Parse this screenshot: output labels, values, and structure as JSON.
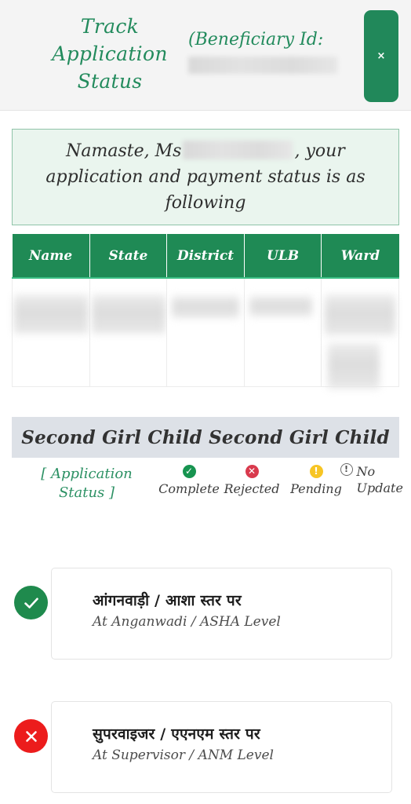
{
  "header": {
    "title": "Track Application Status",
    "beneficiary_label": "(Beneficiary Id:",
    "beneficiary_value": "",
    "close_label": "×"
  },
  "greeting": {
    "prefix": "Namaste, Ms",
    "name_value": "",
    "suffix": ", your application and payment status is as following"
  },
  "table": {
    "columns": [
      "Name",
      "State",
      "District",
      "ULB",
      "Ward"
    ],
    "rows": [
      {
        "Name": "",
        "State": "",
        "District": "",
        "ULB": "",
        "Ward": ""
      }
    ]
  },
  "section": {
    "header": "Second Girl Child Second Girl Child"
  },
  "legend": {
    "title": "[ Application Status ]",
    "items": [
      {
        "label": "Complete",
        "icon": "check-circle-icon",
        "glyph": "✓",
        "color": "#179450"
      },
      {
        "label": "Rejected",
        "icon": "x-circle-icon",
        "glyph": "✕",
        "color": "#d93a4d"
      },
      {
        "label": "Pending",
        "icon": "exclamation-circle-icon",
        "glyph": "!",
        "color": "#f7c524"
      },
      {
        "label": "No Update",
        "icon": "info-circle-outline-icon",
        "glyph": "!",
        "color": "#6b6b6b"
      }
    ]
  },
  "status_steps": [
    {
      "title_hi": "आंगनवाड़ी / आशा स्तर पर",
      "title_en": "At Anganwadi / ASHA Level",
      "status": "Complete",
      "icon": "check-circle-icon",
      "color": "#1f8a4d"
    },
    {
      "title_hi": "सुपरवाइजर / एएनएम स्तर पर",
      "title_en": "At Supervisor / ANM Level",
      "status": "Rejected",
      "icon": "x-circle-icon",
      "color": "#ec1c1c"
    }
  ],
  "colors": {
    "brand_green": "#21885a",
    "table_header_green": "#1f8a55",
    "banner_bg": "#eaf5ee",
    "section_bg": "#dde1e7",
    "complete": "#179450",
    "rejected": "#d93a4d",
    "pending": "#f7c524",
    "no_update": "#6b6b6b"
  }
}
